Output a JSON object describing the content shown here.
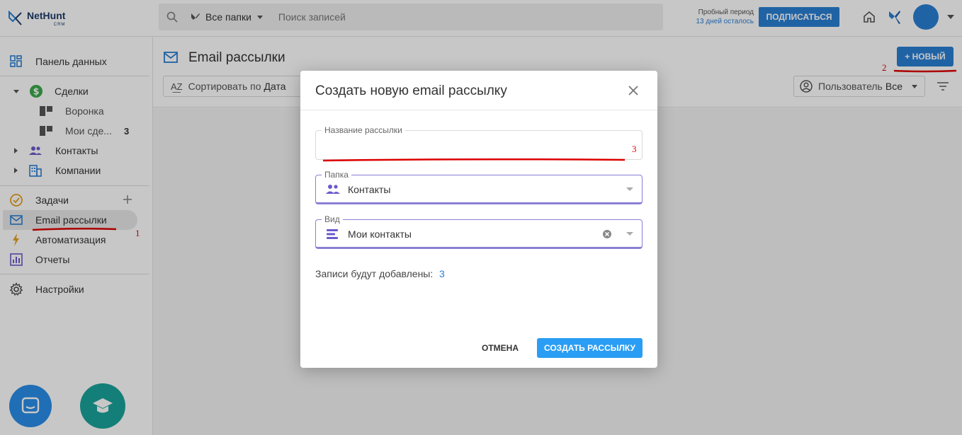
{
  "app": {
    "logo_text": "NetHunt",
    "logo_sub": "CRM"
  },
  "topbar": {
    "folder_selector": "Все папки",
    "search_placeholder": "Поиск записей",
    "trial_line1": "Пробный период",
    "trial_line2": "13 дней осталось",
    "subscribe_label": "ПОДПИСАТЬСЯ"
  },
  "sidebar": {
    "dashboard": "Панель данных",
    "deals": "Сделки",
    "funnel": "Воронка",
    "my_deals": "Мои сде...",
    "my_deals_count": "3",
    "contacts": "Контакты",
    "companies": "Компании",
    "tasks": "Задачи",
    "email_campaigns": "Email рассылки",
    "automation": "Автоматизация",
    "reports": "Отчеты",
    "settings": "Настройки"
  },
  "main": {
    "title": "Email рассылки",
    "new_button": "+ НОВЫЙ",
    "sort_prefix": "Сортировать по",
    "sort_value": "Дата",
    "user_filter_prefix": "Пользователь",
    "user_filter_value": "Все"
  },
  "modal": {
    "title": "Создать новую email рассылку",
    "name_label": "Название рассылки",
    "name_value": "",
    "folder_label": "Папка",
    "folder_value": "Контакты",
    "view_label": "Вид",
    "view_value": "Мои контакты",
    "records_label": "Записи будут добавлены:",
    "records_count": "3",
    "cancel_label": "ОТМЕНА",
    "create_label": "СОЗДАТЬ РАССЫЛКУ"
  },
  "annotations": {
    "mark1": "1",
    "mark2": "2",
    "mark3": "3"
  },
  "colors": {
    "accent_blue": "#2a7fd4",
    "field_purple": "#8a7fd6",
    "annotation_red": "#dd0000",
    "edu_teal": "#1aa39b"
  }
}
